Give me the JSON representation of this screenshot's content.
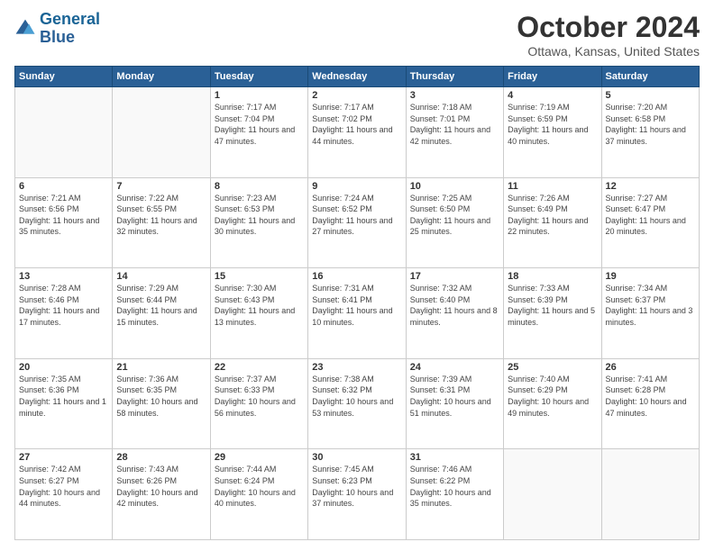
{
  "logo": {
    "line1": "General",
    "line2": "Blue"
  },
  "title": "October 2024",
  "subtitle": "Ottawa, Kansas, United States",
  "weekdays": [
    "Sunday",
    "Monday",
    "Tuesday",
    "Wednesday",
    "Thursday",
    "Friday",
    "Saturday"
  ],
  "weeks": [
    [
      {
        "day": "",
        "info": ""
      },
      {
        "day": "",
        "info": ""
      },
      {
        "day": "1",
        "info": "Sunrise: 7:17 AM\nSunset: 7:04 PM\nDaylight: 11 hours and 47 minutes."
      },
      {
        "day": "2",
        "info": "Sunrise: 7:17 AM\nSunset: 7:02 PM\nDaylight: 11 hours and 44 minutes."
      },
      {
        "day": "3",
        "info": "Sunrise: 7:18 AM\nSunset: 7:01 PM\nDaylight: 11 hours and 42 minutes."
      },
      {
        "day": "4",
        "info": "Sunrise: 7:19 AM\nSunset: 6:59 PM\nDaylight: 11 hours and 40 minutes."
      },
      {
        "day": "5",
        "info": "Sunrise: 7:20 AM\nSunset: 6:58 PM\nDaylight: 11 hours and 37 minutes."
      }
    ],
    [
      {
        "day": "6",
        "info": "Sunrise: 7:21 AM\nSunset: 6:56 PM\nDaylight: 11 hours and 35 minutes."
      },
      {
        "day": "7",
        "info": "Sunrise: 7:22 AM\nSunset: 6:55 PM\nDaylight: 11 hours and 32 minutes."
      },
      {
        "day": "8",
        "info": "Sunrise: 7:23 AM\nSunset: 6:53 PM\nDaylight: 11 hours and 30 minutes."
      },
      {
        "day": "9",
        "info": "Sunrise: 7:24 AM\nSunset: 6:52 PM\nDaylight: 11 hours and 27 minutes."
      },
      {
        "day": "10",
        "info": "Sunrise: 7:25 AM\nSunset: 6:50 PM\nDaylight: 11 hours and 25 minutes."
      },
      {
        "day": "11",
        "info": "Sunrise: 7:26 AM\nSunset: 6:49 PM\nDaylight: 11 hours and 22 minutes."
      },
      {
        "day": "12",
        "info": "Sunrise: 7:27 AM\nSunset: 6:47 PM\nDaylight: 11 hours and 20 minutes."
      }
    ],
    [
      {
        "day": "13",
        "info": "Sunrise: 7:28 AM\nSunset: 6:46 PM\nDaylight: 11 hours and 17 minutes."
      },
      {
        "day": "14",
        "info": "Sunrise: 7:29 AM\nSunset: 6:44 PM\nDaylight: 11 hours and 15 minutes."
      },
      {
        "day": "15",
        "info": "Sunrise: 7:30 AM\nSunset: 6:43 PM\nDaylight: 11 hours and 13 minutes."
      },
      {
        "day": "16",
        "info": "Sunrise: 7:31 AM\nSunset: 6:41 PM\nDaylight: 11 hours and 10 minutes."
      },
      {
        "day": "17",
        "info": "Sunrise: 7:32 AM\nSunset: 6:40 PM\nDaylight: 11 hours and 8 minutes."
      },
      {
        "day": "18",
        "info": "Sunrise: 7:33 AM\nSunset: 6:39 PM\nDaylight: 11 hours and 5 minutes."
      },
      {
        "day": "19",
        "info": "Sunrise: 7:34 AM\nSunset: 6:37 PM\nDaylight: 11 hours and 3 minutes."
      }
    ],
    [
      {
        "day": "20",
        "info": "Sunrise: 7:35 AM\nSunset: 6:36 PM\nDaylight: 11 hours and 1 minute."
      },
      {
        "day": "21",
        "info": "Sunrise: 7:36 AM\nSunset: 6:35 PM\nDaylight: 10 hours and 58 minutes."
      },
      {
        "day": "22",
        "info": "Sunrise: 7:37 AM\nSunset: 6:33 PM\nDaylight: 10 hours and 56 minutes."
      },
      {
        "day": "23",
        "info": "Sunrise: 7:38 AM\nSunset: 6:32 PM\nDaylight: 10 hours and 53 minutes."
      },
      {
        "day": "24",
        "info": "Sunrise: 7:39 AM\nSunset: 6:31 PM\nDaylight: 10 hours and 51 minutes."
      },
      {
        "day": "25",
        "info": "Sunrise: 7:40 AM\nSunset: 6:29 PM\nDaylight: 10 hours and 49 minutes."
      },
      {
        "day": "26",
        "info": "Sunrise: 7:41 AM\nSunset: 6:28 PM\nDaylight: 10 hours and 47 minutes."
      }
    ],
    [
      {
        "day": "27",
        "info": "Sunrise: 7:42 AM\nSunset: 6:27 PM\nDaylight: 10 hours and 44 minutes."
      },
      {
        "day": "28",
        "info": "Sunrise: 7:43 AM\nSunset: 6:26 PM\nDaylight: 10 hours and 42 minutes."
      },
      {
        "day": "29",
        "info": "Sunrise: 7:44 AM\nSunset: 6:24 PM\nDaylight: 10 hours and 40 minutes."
      },
      {
        "day": "30",
        "info": "Sunrise: 7:45 AM\nSunset: 6:23 PM\nDaylight: 10 hours and 37 minutes."
      },
      {
        "day": "31",
        "info": "Sunrise: 7:46 AM\nSunset: 6:22 PM\nDaylight: 10 hours and 35 minutes."
      },
      {
        "day": "",
        "info": ""
      },
      {
        "day": "",
        "info": ""
      }
    ]
  ]
}
